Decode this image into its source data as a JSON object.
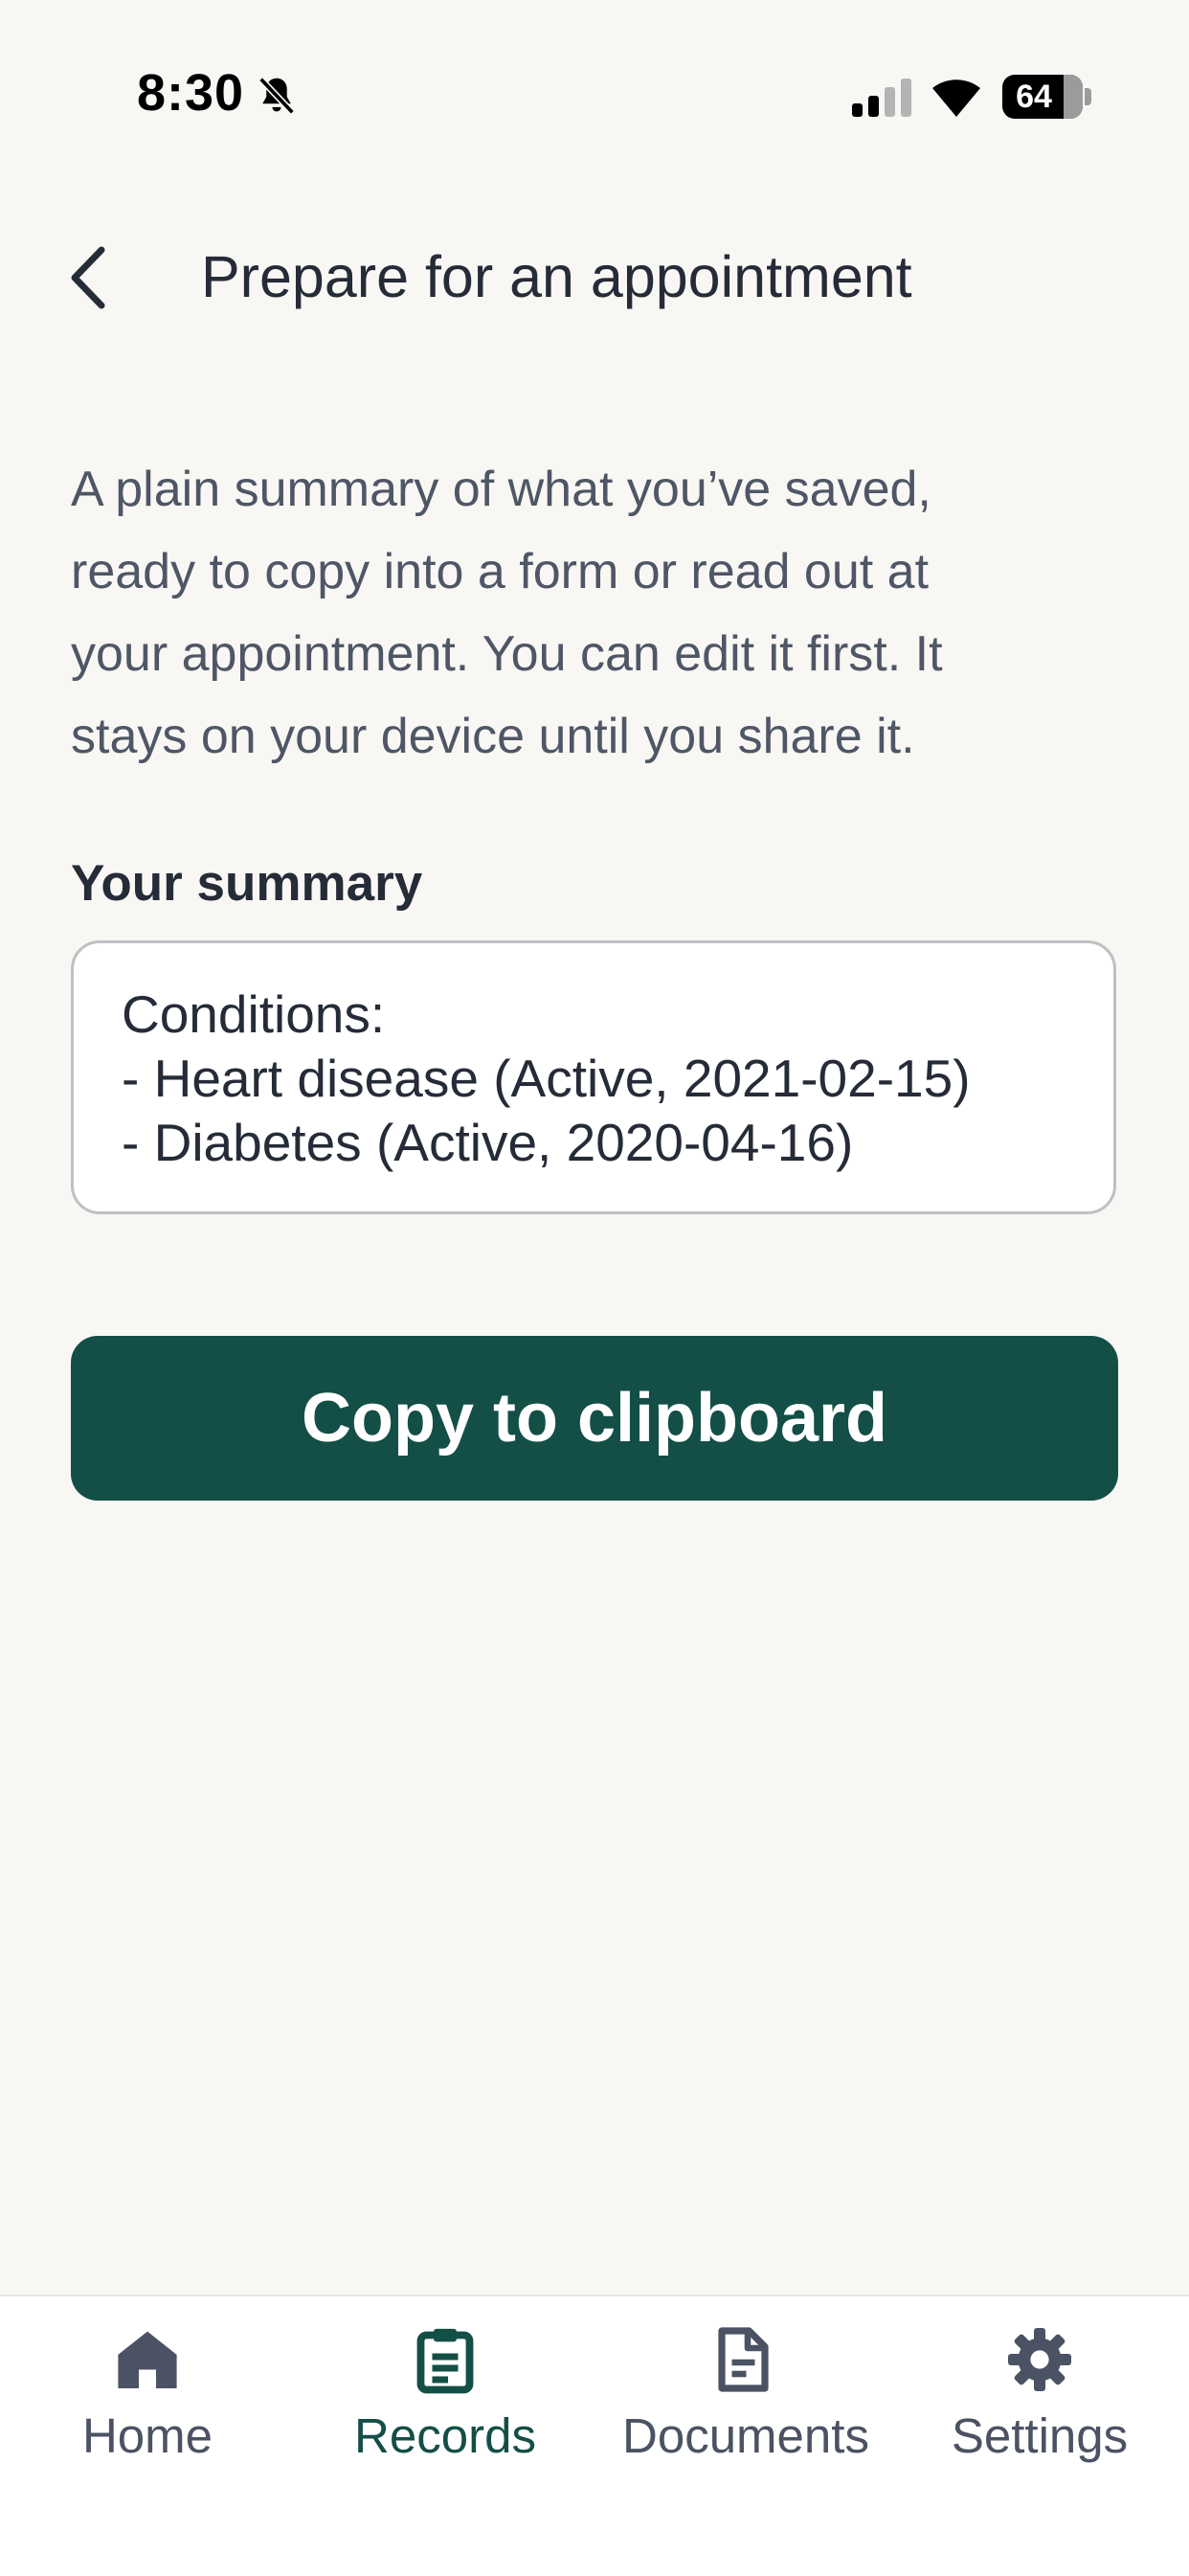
{
  "status_bar": {
    "time": "8:30",
    "battery": "64"
  },
  "header": {
    "title": "Prepare for an appointment"
  },
  "intro": {
    "lines": [
      "A plain summary of what you’ve saved,",
      "ready to copy into a form or read out at",
      "your appointment. You can edit it first. It",
      "stays on your device until you share it."
    ]
  },
  "summary": {
    "label": "Your summary",
    "lines": [
      "Conditions:",
      "- Heart disease (Active, 2021-02-15)",
      "- Diabetes (Active, 2020-04-16)"
    ]
  },
  "copy_button": {
    "label": "Copy to clipboard"
  },
  "tabs": [
    {
      "label": "Home",
      "icon": "home-icon",
      "active": false
    },
    {
      "label": "Records",
      "icon": "clipboard-icon",
      "active": true
    },
    {
      "label": "Documents",
      "icon": "document-icon",
      "active": false
    },
    {
      "label": "Settings",
      "icon": "gear-icon",
      "active": false
    }
  ],
  "colors": {
    "accent": "#134f47",
    "background": "#f8f7f4",
    "text": "#262b38",
    "muted": "#4f5665"
  }
}
